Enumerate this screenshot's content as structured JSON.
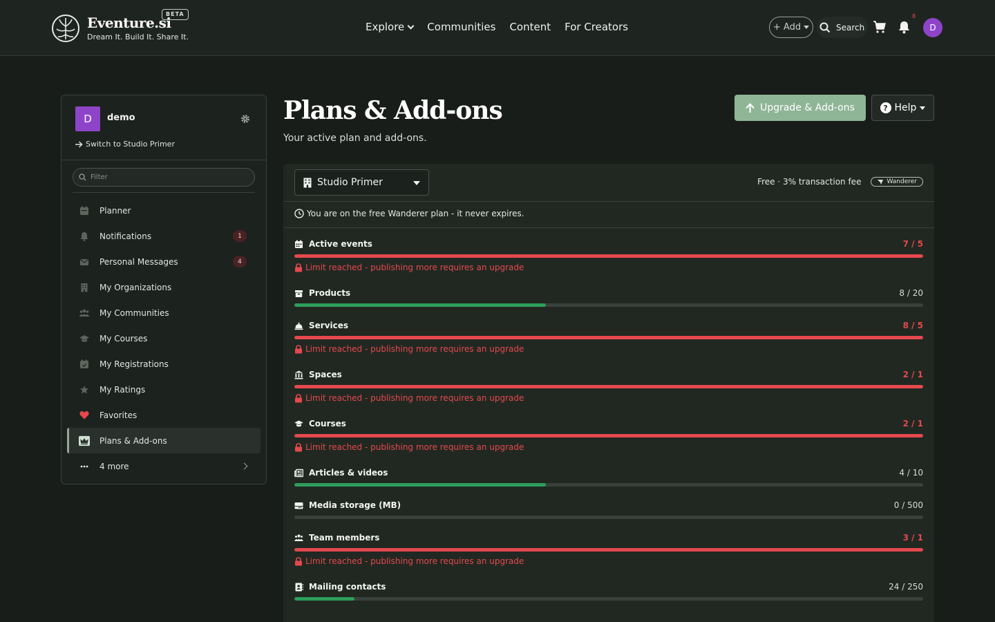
{
  "brand": {
    "name": "Eventure.si",
    "beta": "BETA",
    "tagline": "Dream It. Build It. Share It."
  },
  "nav": {
    "items": [
      "Explore",
      "Communities",
      "Content",
      "For Creators"
    ]
  },
  "header": {
    "add_label": "+ Add",
    "search_label": "Search",
    "notif_count": "8",
    "avatar_initial": "D"
  },
  "sidebar": {
    "account": {
      "initial": "D",
      "name": "demo",
      "switch_label": "Switch to Studio Primer"
    },
    "filter_placeholder": "Filter",
    "items": [
      {
        "label": "Planner",
        "icon": "calendar-icon"
      },
      {
        "label": "Notifications",
        "icon": "bell-icon",
        "badge": "1"
      },
      {
        "label": "Personal Messages",
        "icon": "envelope-icon",
        "badge": "4"
      },
      {
        "label": "My Organizations",
        "icon": "building-icon"
      },
      {
        "label": "My Communities",
        "icon": "users-icon"
      },
      {
        "label": "My Courses",
        "icon": "graduation-cap-icon"
      },
      {
        "label": "My Registrations",
        "icon": "calendar-check-icon"
      },
      {
        "label": "My Ratings",
        "icon": "star-icon"
      },
      {
        "label": "Favorites",
        "icon": "heart-icon"
      },
      {
        "label": "Plans & Add-ons",
        "icon": "crown-icon",
        "active": true
      },
      {
        "label": "4 more",
        "icon": "ellipsis-icon"
      }
    ]
  },
  "main": {
    "title": "Plans & Add-ons",
    "subtitle": "Your active plan and add-ons.",
    "upgrade_label": "Upgrade & Add-ons",
    "help_label": "Help",
    "org_select": "Studio Primer",
    "plan_summary": "Free · 3% transaction fee",
    "plan_badge": "Wanderer",
    "notice": "You are on the free Wanderer plan - it never expires.",
    "limit_warning": "Limit reached - publishing more requires an upgrade",
    "colors": {
      "over": "#e5484d",
      "ok": "#2e9e5b",
      "accent": "#8fb597"
    },
    "limits": [
      {
        "name": "Active events",
        "count": "7 / 5",
        "used": 7,
        "max": 5,
        "over": true,
        "icon": "calendar-icon"
      },
      {
        "name": "Products",
        "count": "8 / 20",
        "used": 8,
        "max": 20,
        "over": false,
        "icon": "box-icon"
      },
      {
        "name": "Services",
        "count": "8 / 5",
        "used": 8,
        "max": 5,
        "over": true,
        "icon": "bell-service-icon"
      },
      {
        "name": "Spaces",
        "count": "2 / 1",
        "used": 2,
        "max": 1,
        "over": true,
        "icon": "landmark-icon"
      },
      {
        "name": "Courses",
        "count": "2 / 1",
        "used": 2,
        "max": 1,
        "over": true,
        "icon": "graduation-cap-icon"
      },
      {
        "name": "Articles & videos",
        "count": "4 / 10",
        "used": 4,
        "max": 10,
        "over": false,
        "icon": "newspaper-icon"
      },
      {
        "name": "Media storage (MB)",
        "count": "0 / 500",
        "used": 0,
        "max": 500,
        "over": false,
        "icon": "hdd-icon"
      },
      {
        "name": "Team members",
        "count": "3 / 1",
        "used": 3,
        "max": 1,
        "over": true,
        "icon": "users-icon"
      },
      {
        "name": "Mailing contacts",
        "count": "24 / 250",
        "used": 24,
        "max": 250,
        "over": false,
        "icon": "address-book-icon"
      }
    ]
  }
}
